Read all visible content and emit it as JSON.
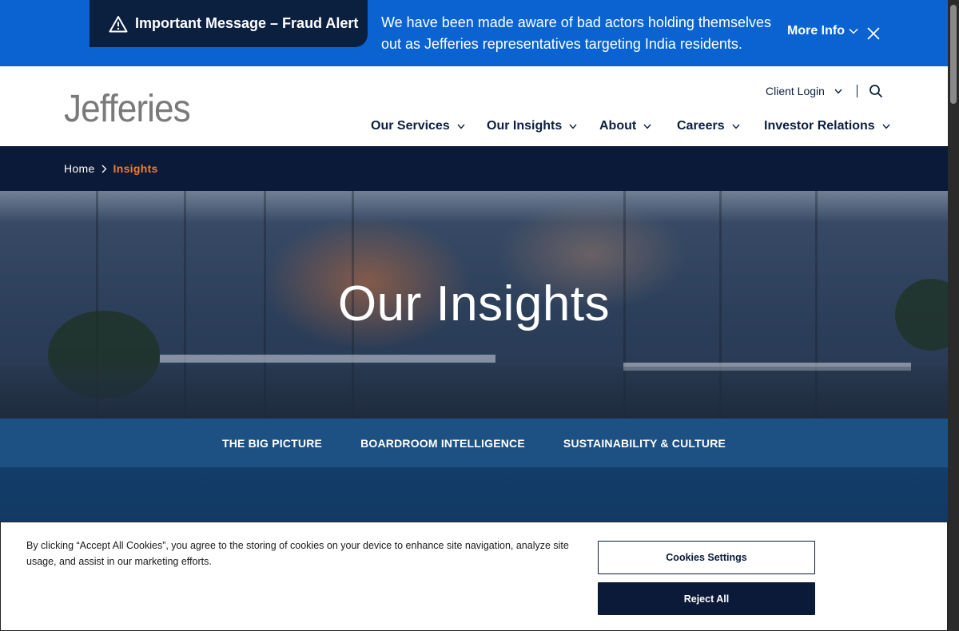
{
  "alert": {
    "title": "Important Message – Fraud Alert",
    "message": "We have been made aware of bad actors holding themselves out as Jefferies representatives targeting India residents.",
    "more_info": "More Info",
    "icons": {
      "warning": "warning-triangle-icon",
      "chevron": "chevron-down-icon",
      "close": "close-icon"
    }
  },
  "header": {
    "logo": "Jefferies",
    "client_login": "Client Login",
    "nav": [
      {
        "label": "Our Services"
      },
      {
        "label": "Our Insights"
      },
      {
        "label": "About"
      },
      {
        "label": "Careers"
      },
      {
        "label": "Investor Relations"
      }
    ]
  },
  "breadcrumb": {
    "home": "Home",
    "current": "Insights"
  },
  "hero": {
    "title": "Our Insights"
  },
  "subtabs": [
    {
      "label": "THE BIG PICTURE"
    },
    {
      "label": "BOARDROOM INTELLIGENCE"
    },
    {
      "label": "SUSTAINABILITY & CULTURE"
    }
  ],
  "cookie": {
    "text": "By clicking “Accept All Cookies”, you agree to the storing of cookies on your device to enhance site navigation, analyze site usage, and assist in our marketing efforts.",
    "settings_label": "Cookies Settings",
    "reject_label": "Reject All"
  },
  "colors": {
    "alert_blue": "#0a63d1",
    "navy": "#0b1a38",
    "accent_orange": "#f07f2d",
    "tab_blue": "#1e5183"
  }
}
